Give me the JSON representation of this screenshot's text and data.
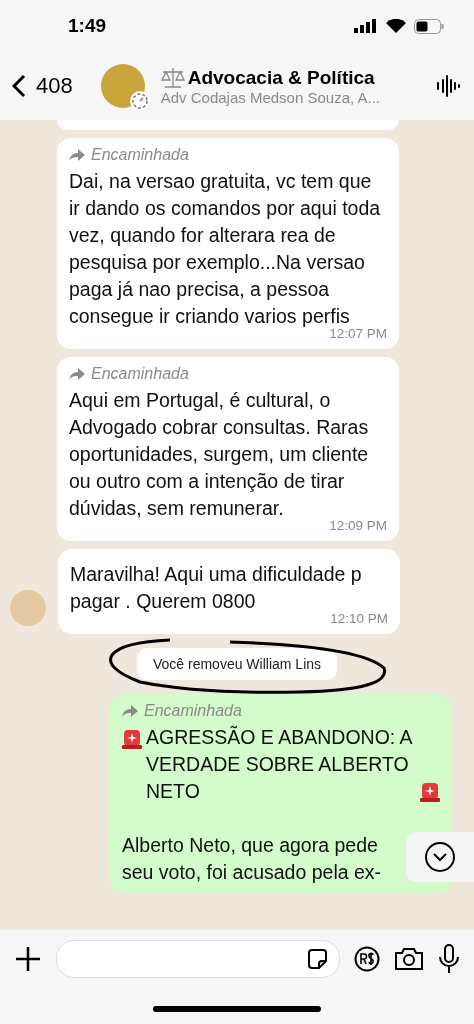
{
  "status_bar": {
    "time": "1:49"
  },
  "header": {
    "back_count": "408",
    "title": "Advocacia & Política",
    "subtitle": "Adv Codajas Medson Souza, A..."
  },
  "messages": [
    {
      "kind": "incoming",
      "forwarded": true,
      "forward_label": "Encaminhada",
      "text": "Dai, na versao gratuita, vc tem que ir dando os comandos por aqui toda vez, quando for alterara rea de pesquisa por exemplo...Na versao paga já nao precisa, a pessoa consegue ir criando varios perfis",
      "time": "12:07 PM"
    },
    {
      "kind": "incoming",
      "forwarded": true,
      "forward_label": "Encaminhada",
      "text": "Aqui em Portugal, é cultural,  o Advogado cobrar consultas. Raras oportunidades, surgem, um cliente ou outro com a intenção de tirar dúvidas, sem remunerar.",
      "time": "12:09 PM"
    },
    {
      "kind": "withavatar",
      "forwarded": false,
      "text": "Maravilha!  Aqui uma dificuldade p pagar . Querem 0800",
      "time": "12:10 PM"
    },
    {
      "kind": "system",
      "text": "Você removeu William Lins"
    },
    {
      "kind": "outgoing",
      "forwarded": true,
      "forward_label": "Encaminhada",
      "title": "AGRESSÃO E ABANDONO: A VERDADE SOBRE ALBERTO NETO",
      "text": "Alberto Neto, que agora pede seu voto, foi acusado pela ex-"
    }
  ]
}
